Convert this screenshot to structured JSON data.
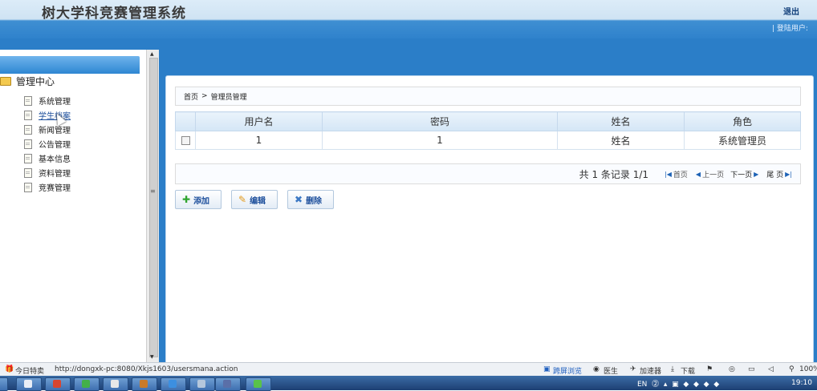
{
  "header": {
    "title": "树大学科竞赛管理系统",
    "logout": "退出",
    "login_user": "| 登陆用户:"
  },
  "sidebar": {
    "root": "管理中心",
    "items": [
      {
        "label": "系统管理"
      },
      {
        "label": "学生档案"
      },
      {
        "label": "新闻管理"
      },
      {
        "label": "公告管理"
      },
      {
        "label": "基本信息"
      },
      {
        "label": "资料管理"
      },
      {
        "label": "竞赛管理"
      }
    ]
  },
  "breadcrumb": {
    "home": "首页",
    "separator": ">",
    "current": "管理员管理"
  },
  "table": {
    "columns": [
      "用户名",
      "密码",
      "姓名",
      "角色"
    ],
    "rows": [
      {
        "username": "1",
        "password": "1",
        "name": "姓名",
        "role": "系统管理员"
      }
    ]
  },
  "pager": {
    "summary": "共 1 条记录 1/1",
    "first": "首页",
    "prev": "上一页",
    "next": "下一页",
    "last": "尾 页"
  },
  "actions": {
    "add": "添加",
    "edit": "编辑",
    "delete": "删除"
  },
  "statusbar": {
    "today": "今日特卖",
    "url": "http://dongxk-pc:8080/Xkjs1603/usersmana.action",
    "split_view": "跨屏浏览",
    "doctor": "医生",
    "accelerator": "加速器",
    "download": "下载",
    "zoom": "100%"
  },
  "taskbar": {
    "lang": "EN",
    "time": "19:10"
  },
  "colors": {
    "header_blue": "#2b7ec8",
    "link_blue": "#1d4f9c",
    "add_icon": "#2fa52f",
    "edit_icon": "#e39a1c",
    "delete_icon": "#3b78c4"
  }
}
